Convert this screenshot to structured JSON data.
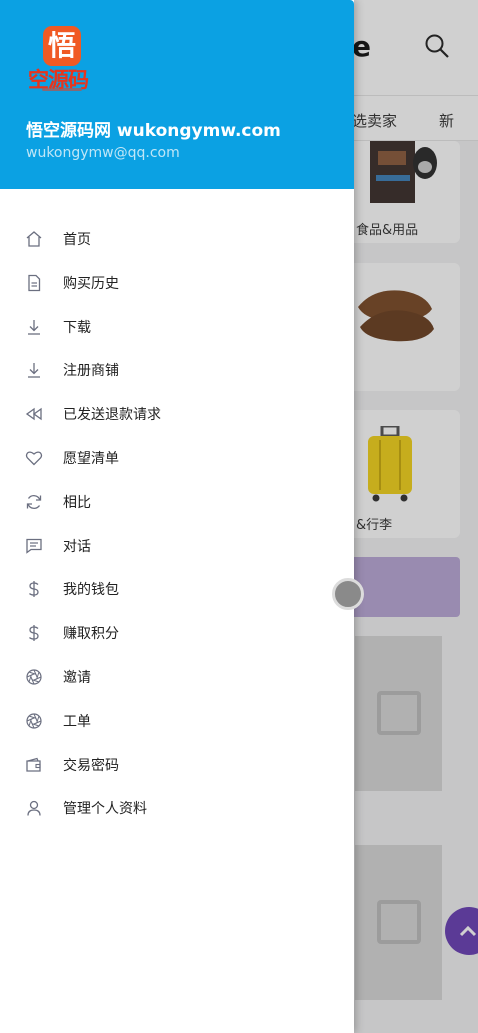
{
  "background": {
    "logo_fragment": "e",
    "tabs": [
      "选卖家",
      "新"
    ],
    "cards": [
      {
        "label": "食品&用品"
      },
      {
        "label": ""
      },
      {
        "label": "&行李"
      }
    ]
  },
  "drawer": {
    "brand": {
      "logo_top": "悟",
      "logo_bottom": "空源码",
      "shop_name": "悟空源码网 wukongymw.com",
      "email": "wukongymw@qq.com"
    },
    "menu": [
      {
        "label": "首页",
        "icon": "home-icon"
      },
      {
        "label": "购买历史",
        "icon": "document-icon"
      },
      {
        "label": "下载",
        "icon": "download-icon"
      },
      {
        "label": "注册商铺",
        "icon": "download-icon"
      },
      {
        "label": "已发送退款请求",
        "icon": "rewind-icon"
      },
      {
        "label": "愿望清单",
        "icon": "heart-icon"
      },
      {
        "label": "相比",
        "icon": "refresh-icon"
      },
      {
        "label": "对话",
        "icon": "message-icon"
      },
      {
        "label": "我的钱包",
        "icon": "dollar-icon"
      },
      {
        "label": "赚取积分",
        "icon": "dollar-icon"
      },
      {
        "label": "邀请",
        "icon": "aperture-icon"
      },
      {
        "label": "工单",
        "icon": "aperture-icon"
      },
      {
        "label": "交易密码",
        "icon": "wallet-icon"
      },
      {
        "label": "管理个人资料",
        "icon": "user-icon"
      }
    ]
  },
  "colors": {
    "header_bg": "#0ba1e3",
    "icon_stroke": "#6b6f80",
    "fab": "#6a3fb5",
    "banner": "#b9a7d6"
  }
}
